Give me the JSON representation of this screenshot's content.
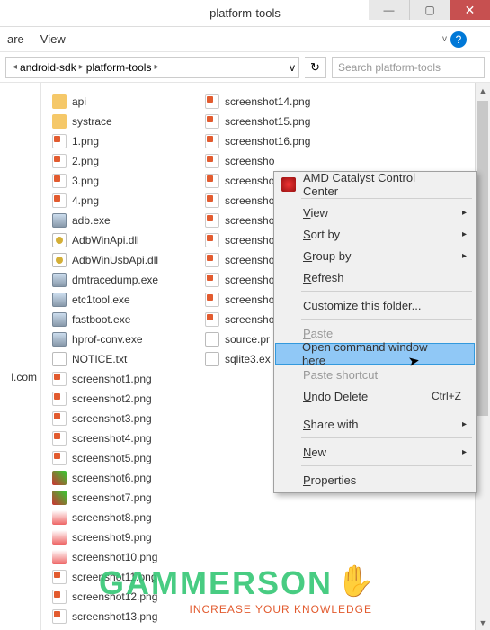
{
  "window": {
    "title": "platform-tools"
  },
  "menubar": {
    "items": [
      "are",
      "View"
    ]
  },
  "breadcrumb": {
    "parts": [
      "android-sdk",
      "platform-tools"
    ],
    "dropdown": "v"
  },
  "search": {
    "placeholder": "Search platform-tools"
  },
  "sidebar": {
    "label": "l.com"
  },
  "files_col1": [
    {
      "name": "api",
      "icon": "folder"
    },
    {
      "name": "systrace",
      "icon": "folder"
    },
    {
      "name": "1.png",
      "icon": "png"
    },
    {
      "name": "2.png",
      "icon": "png"
    },
    {
      "name": "3.png",
      "icon": "png"
    },
    {
      "name": "4.png",
      "icon": "png"
    },
    {
      "name": "adb.exe",
      "icon": "exe"
    },
    {
      "name": "AdbWinApi.dll",
      "icon": "dll"
    },
    {
      "name": "AdbWinUsbApi.dll",
      "icon": "dll"
    },
    {
      "name": "dmtracedump.exe",
      "icon": "exe"
    },
    {
      "name": "etc1tool.exe",
      "icon": "exe"
    },
    {
      "name": "fastboot.exe",
      "icon": "exe"
    },
    {
      "name": "hprof-conv.exe",
      "icon": "exe"
    },
    {
      "name": "NOTICE.txt",
      "icon": "txt"
    },
    {
      "name": "screenshot1.png",
      "icon": "png"
    },
    {
      "name": "screenshot2.png",
      "icon": "png"
    },
    {
      "name": "screenshot3.png",
      "icon": "png"
    },
    {
      "name": "screenshot4.png",
      "icon": "png"
    },
    {
      "name": "screenshot5.png",
      "icon": "png"
    },
    {
      "name": "screenshot6.png",
      "icon": "img"
    },
    {
      "name": "screenshot7.png",
      "icon": "img"
    },
    {
      "name": "screenshot8.png",
      "icon": "img2"
    },
    {
      "name": "screenshot9.png",
      "icon": "img2"
    },
    {
      "name": "screenshot10.png",
      "icon": "img2"
    },
    {
      "name": "screenshot11.png",
      "icon": "png"
    },
    {
      "name": "screenshot12.png",
      "icon": "png"
    }
  ],
  "files_col2": [
    {
      "name": "screenshot13.png",
      "icon": "png"
    },
    {
      "name": "screenshot14.png",
      "icon": "png"
    },
    {
      "name": "screenshot15.png",
      "icon": "png"
    },
    {
      "name": "screenshot16.png",
      "icon": "png"
    },
    {
      "name": "screensho",
      "icon": "png"
    },
    {
      "name": "screensho",
      "icon": "png"
    },
    {
      "name": "screensho",
      "icon": "png"
    },
    {
      "name": "screensho",
      "icon": "png"
    },
    {
      "name": "screensho",
      "icon": "png"
    },
    {
      "name": "screensho",
      "icon": "png"
    },
    {
      "name": "screensho",
      "icon": "png"
    },
    {
      "name": "screensho",
      "icon": "png"
    },
    {
      "name": "screensho",
      "icon": "png"
    },
    {
      "name": "source.pr",
      "icon": "txt"
    },
    {
      "name": "sqlite3.ex",
      "icon": "db"
    }
  ],
  "context_menu": {
    "amd": "AMD Catalyst Control Center",
    "view": "View",
    "sort": "Sort by",
    "group": "Group by",
    "refresh": "Refresh",
    "customize": "Customize this folder...",
    "paste": "Paste",
    "open_cmd": "Open command window here",
    "paste_shortcut": "Paste shortcut",
    "undo": "Undo Delete",
    "undo_key": "Ctrl+Z",
    "share": "Share with",
    "new": "New",
    "properties": "Properties"
  },
  "watermark": {
    "main": "GAMMERSON",
    "sub": "INCREASE YOUR KNOWLEDGE"
  }
}
